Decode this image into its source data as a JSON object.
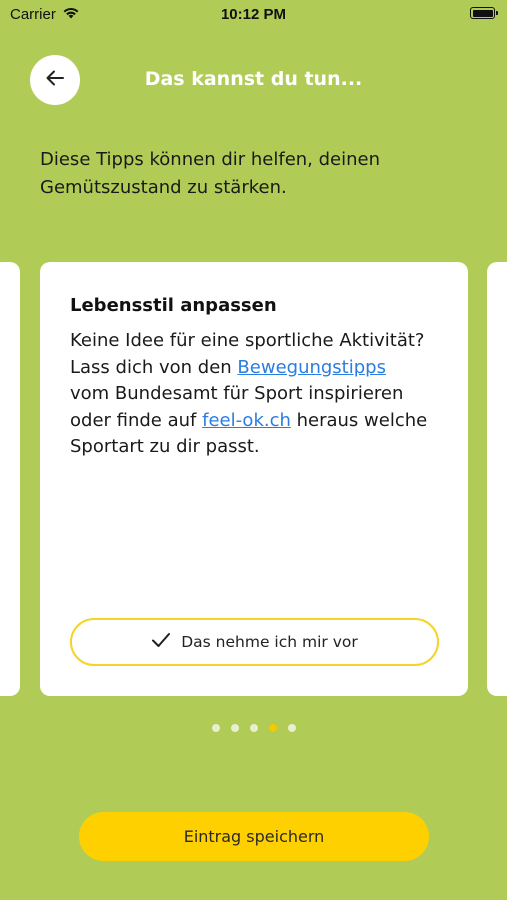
{
  "status_bar": {
    "carrier": "Carrier",
    "time": "10:12 PM"
  },
  "header": {
    "title": "Das kannst du tun..."
  },
  "intro": {
    "text": "Diese Tipps können dir helfen, deinen Gemütszustand zu stärken."
  },
  "card": {
    "title": "Lebensstil anpassen",
    "body_part1": "Keine Idee für eine sportliche Aktivität? Lass dich von den ",
    "link1": "Bewegungstipps",
    "body_part2": " vom Bundesamt für Sport inspirieren oder finde auf ",
    "link2": "feel-ok.ch",
    "body_part3": " heraus welche Sportart zu dir passt.",
    "commit_label": "Das nehme ich mir vor",
    "link_color": "#2a7de1",
    "commit_border_color": "#F5D327"
  },
  "pager": {
    "count": 5,
    "active_index": 3
  },
  "footer": {
    "save_label": "Eintrag speichern",
    "save_color": "#FFD000"
  },
  "theme": {
    "background": "#B0CC57",
    "dot_active": "#F5C800"
  },
  "icons": {
    "back": "arrow-left-icon",
    "commit": "checkmark-icon",
    "wifi": "wifi-icon",
    "battery": "battery-icon"
  }
}
